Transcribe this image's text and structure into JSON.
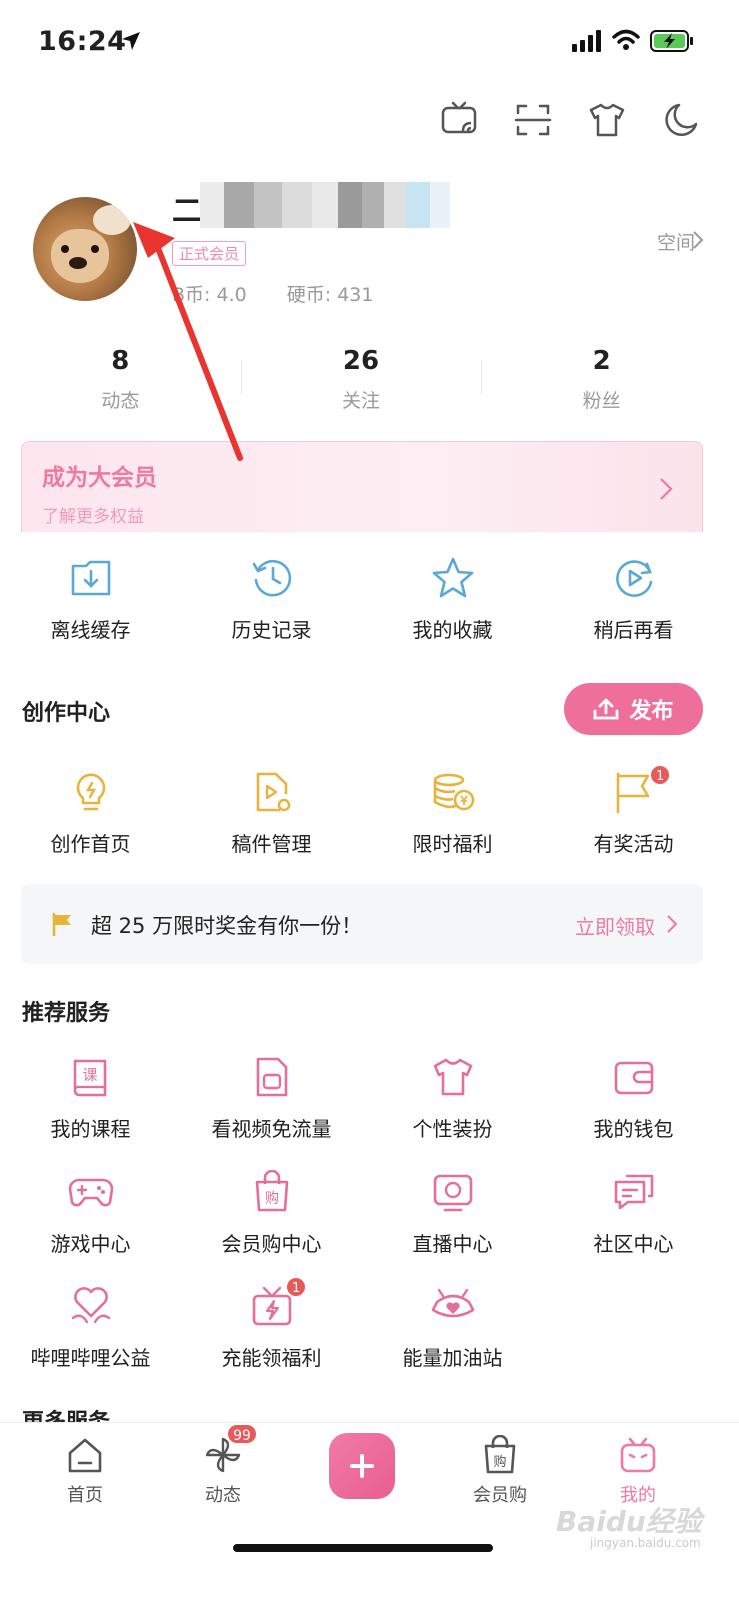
{
  "status_bar": {
    "time": "16:24"
  },
  "profile": {
    "name_prefix": "二",
    "vip_tag": "正式会员",
    "b_coins": "B币: 4.0",
    "coins": "硬币: 431",
    "space_label": "空间"
  },
  "stats": [
    {
      "value": "8",
      "label": "动态"
    },
    {
      "value": "26",
      "label": "关注"
    },
    {
      "value": "2",
      "label": "粉丝"
    }
  ],
  "vip_banner": {
    "title": "成为大会员",
    "subtitle": "了解更多权益"
  },
  "quick_actions": [
    {
      "label": "离线缓存",
      "icon": "download-folder-icon"
    },
    {
      "label": "历史记录",
      "icon": "history-clock-icon"
    },
    {
      "label": "我的收藏",
      "icon": "star-icon"
    },
    {
      "label": "稍后再看",
      "icon": "watch-later-icon"
    }
  ],
  "creation_center": {
    "title": "创作中心",
    "publish_label": "发布",
    "items": [
      {
        "label": "创作首页",
        "icon": "lightbulb-icon",
        "badge": ""
      },
      {
        "label": "稿件管理",
        "icon": "manuscript-icon",
        "badge": ""
      },
      {
        "label": "限时福利",
        "icon": "coin-stack-icon",
        "badge": ""
      },
      {
        "label": "有奖活动",
        "icon": "flag-icon",
        "badge": "1"
      }
    ]
  },
  "promo": {
    "text": "超 25 万限时奖金有你一份！",
    "link": "立即领取"
  },
  "recommended": {
    "title": "推荐服务",
    "items": [
      {
        "label": "我的课程",
        "icon": "course-book-icon",
        "badge": ""
      },
      {
        "label": "看视频免流量",
        "icon": "sim-card-icon",
        "badge": ""
      },
      {
        "label": "个性装扮",
        "icon": "tshirt-icon",
        "badge": ""
      },
      {
        "label": "我的钱包",
        "icon": "wallet-icon",
        "badge": ""
      },
      {
        "label": "游戏中心",
        "icon": "gamepad-icon",
        "badge": ""
      },
      {
        "label": "会员购中心",
        "icon": "shopping-bag-icon",
        "badge": ""
      },
      {
        "label": "直播中心",
        "icon": "live-tv-icon",
        "badge": ""
      },
      {
        "label": "社区中心",
        "icon": "chat-bubble-icon",
        "badge": ""
      },
      {
        "label": "哔哩哔哩公益",
        "icon": "heart-hands-icon",
        "badge": ""
      },
      {
        "label": "充能领福利",
        "icon": "gift-bolt-icon",
        "badge": "1"
      },
      {
        "label": "能量加油站",
        "icon": "energy-station-icon",
        "badge": ""
      }
    ]
  },
  "more_services": {
    "title": "更多服务"
  },
  "tabbar": {
    "items": [
      {
        "label": "首页",
        "icon": "home-icon"
      },
      {
        "label": "动态",
        "icon": "pinwheel-icon",
        "badge": "99"
      },
      {
        "label": "",
        "icon": "plus-icon"
      },
      {
        "label": "会员购",
        "icon": "shopping-bag-icon"
      },
      {
        "label": "我的",
        "icon": "tv-mascot-icon"
      }
    ]
  },
  "watermark": {
    "logo": "Baidu经验",
    "domain": "jingyan.baidu.com"
  },
  "colors": {
    "accent_pink": "#ee6f9a",
    "icon_blue": "#5aa8d6",
    "icon_gold": "#e8b33a",
    "badge_red": "#e85a5a"
  }
}
